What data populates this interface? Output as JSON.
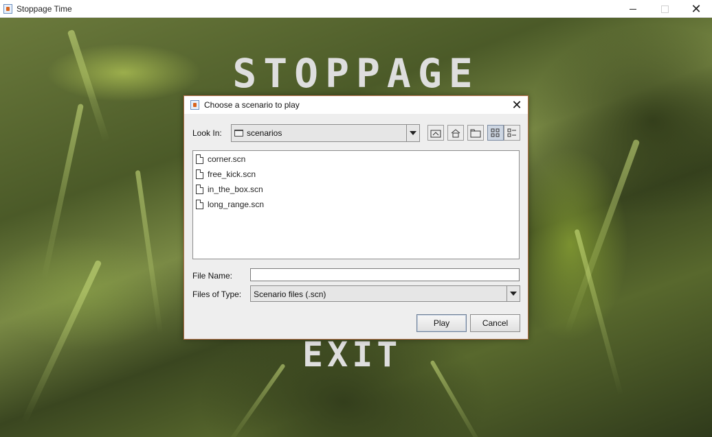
{
  "window": {
    "title": "Stoppage Time",
    "minimize_glyph": "",
    "close_glyph": "✕"
  },
  "game": {
    "title": "STOPPAGE TIME",
    "exit_label": "EXIT"
  },
  "dialog": {
    "title": "Choose a scenario to play",
    "close_glyph": "✕",
    "look_in_label": "Look In:",
    "look_in_value": "scenarios",
    "toolbar": {
      "icons": [
        "up-one-level-icon",
        "home-icon",
        "new-folder-icon",
        "list-view-icon",
        "details-view-icon"
      ],
      "selected": "list-view"
    },
    "files": [
      {
        "name": "corner.scn"
      },
      {
        "name": "free_kick.scn"
      },
      {
        "name": "in_the_box.scn"
      },
      {
        "name": "long_range.scn"
      }
    ],
    "file_name_label": "File Name:",
    "file_name_value": "",
    "files_of_type_label": "Files of Type:",
    "files_of_type_value": "Scenario files (.scn)",
    "play_label": "Play",
    "cancel_label": "Cancel"
  },
  "colors": {
    "dialog_border": "#b8704a",
    "dialog_bg": "#eeeeee",
    "selected_tool": "#cdd6e2"
  }
}
